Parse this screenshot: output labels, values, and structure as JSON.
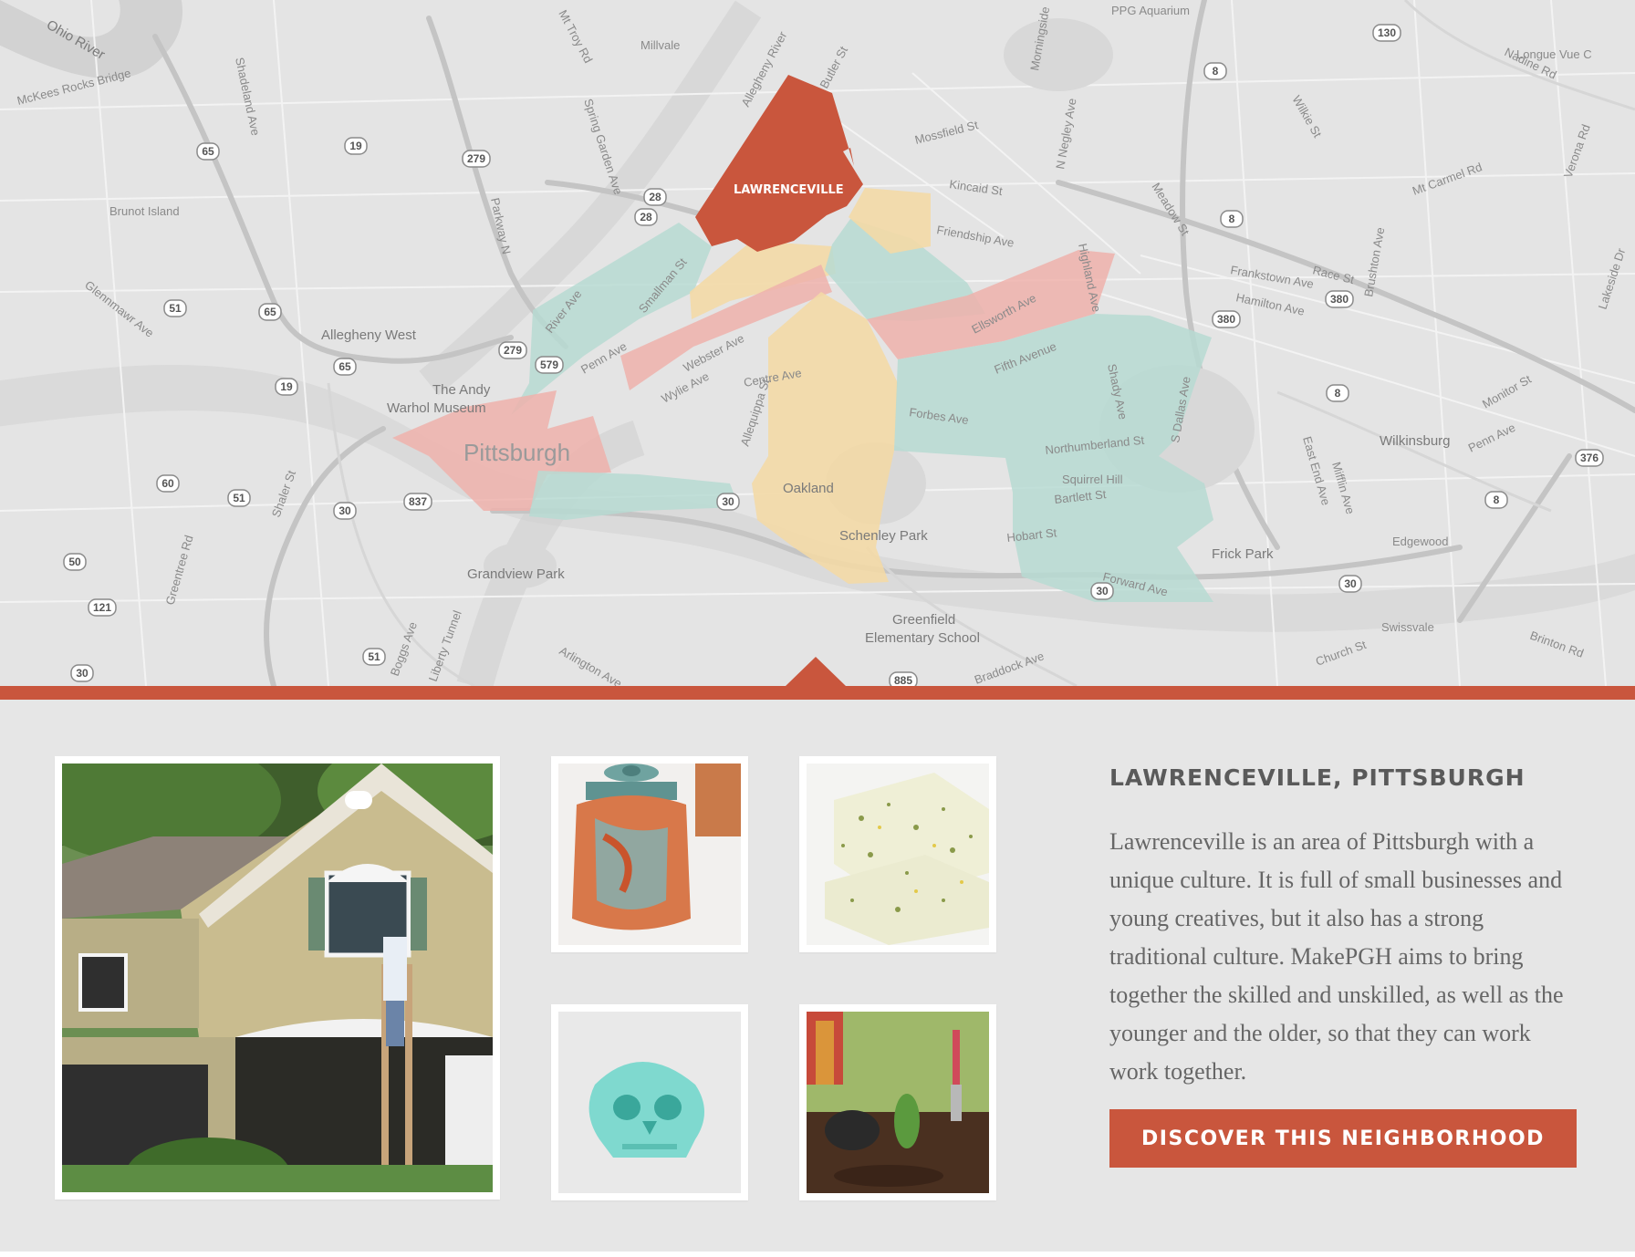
{
  "map": {
    "selected_label": "LAWRENCEVILLE",
    "city_label": "Pittsburgh",
    "places": [
      "Ohio River",
      "McKees Rocks Bridge",
      "Brunot Island",
      "Millvale",
      "Allegheny River",
      "Allegheny West",
      "The Andy",
      "Warhol Museum",
      "Grandview Park",
      "Oakland",
      "Schenley Park",
      "Greenfield",
      "Elementary School",
      "Frick Park",
      "Wilkinsburg",
      "Edgewood",
      "Swissvale",
      "PPG Aquarium",
      "Longue Vue C",
      "Squirrel Hill"
    ],
    "streets": [
      "Penn Ave",
      "Smallman St",
      "Butler St",
      "Friendship Ave",
      "Ellsworth Ave",
      "Fifth Avenue",
      "Forbes Ave",
      "Webster Ave",
      "Wylie Ave",
      "Centre Ave",
      "Mossfield St",
      "Kincaid St",
      "Highland Ave",
      "Frankstown Ave",
      "Hamilton Ave",
      "Northumberland St",
      "Bartlett St",
      "Hobart St",
      "Forward Ave",
      "Shady Ave",
      "S Dallas Ave",
      "Meadow St",
      "N Negley Ave",
      "Parkway N",
      "River Ave",
      "Boggs Ave",
      "Liberty Tunnel",
      "Arlington Ave",
      "Shaler St",
      "Greentree Rd",
      "Brinton Rd",
      "Church St",
      "Braddock Ave",
      "Penn Ave",
      "Monitor St",
      "Nadine Rd",
      "Mt Carmel Rd",
      "Verona Rd",
      "Wilkie St",
      "Race St",
      "Brushton Ave",
      "Spring Garden Ave",
      "Mt Troy Rd",
      "Shadeland Ave",
      "Glennmawr Ave",
      "East End Ave",
      "Mifflin Ave",
      "Lakeside Dr",
      "Allequippa St",
      "Morningside"
    ],
    "route_shields": [
      "130",
      "8",
      "65",
      "19",
      "279",
      "28",
      "28",
      "51",
      "65",
      "279",
      "579",
      "19",
      "65",
      "60",
      "51",
      "30",
      "837",
      "30",
      "50",
      "121",
      "51",
      "30",
      "885",
      "30",
      "30",
      "380",
      "380",
      "8",
      "8",
      "376",
      "8"
    ]
  },
  "neighborhood": {
    "title": "LAWRENCEVILLE, PITTSBURGH",
    "body": "Lawrenceville is an area of Pittsburgh with a unique culture. It is full of small businesses and young creatives, but it also has a strong traditional culture. MakePGH aims to bring together the skilled and unskilled, as well as the younger and the older, so that they can work work together.",
    "cta_label": "DISCOVER THIS NEIGHBORHOOD"
  },
  "colors": {
    "accent": "#c9563d",
    "region_teal": "#b7dad2",
    "region_pink": "#eeb1ac",
    "region_yellow": "#f3d9a6",
    "background": "#e6e6e6"
  }
}
